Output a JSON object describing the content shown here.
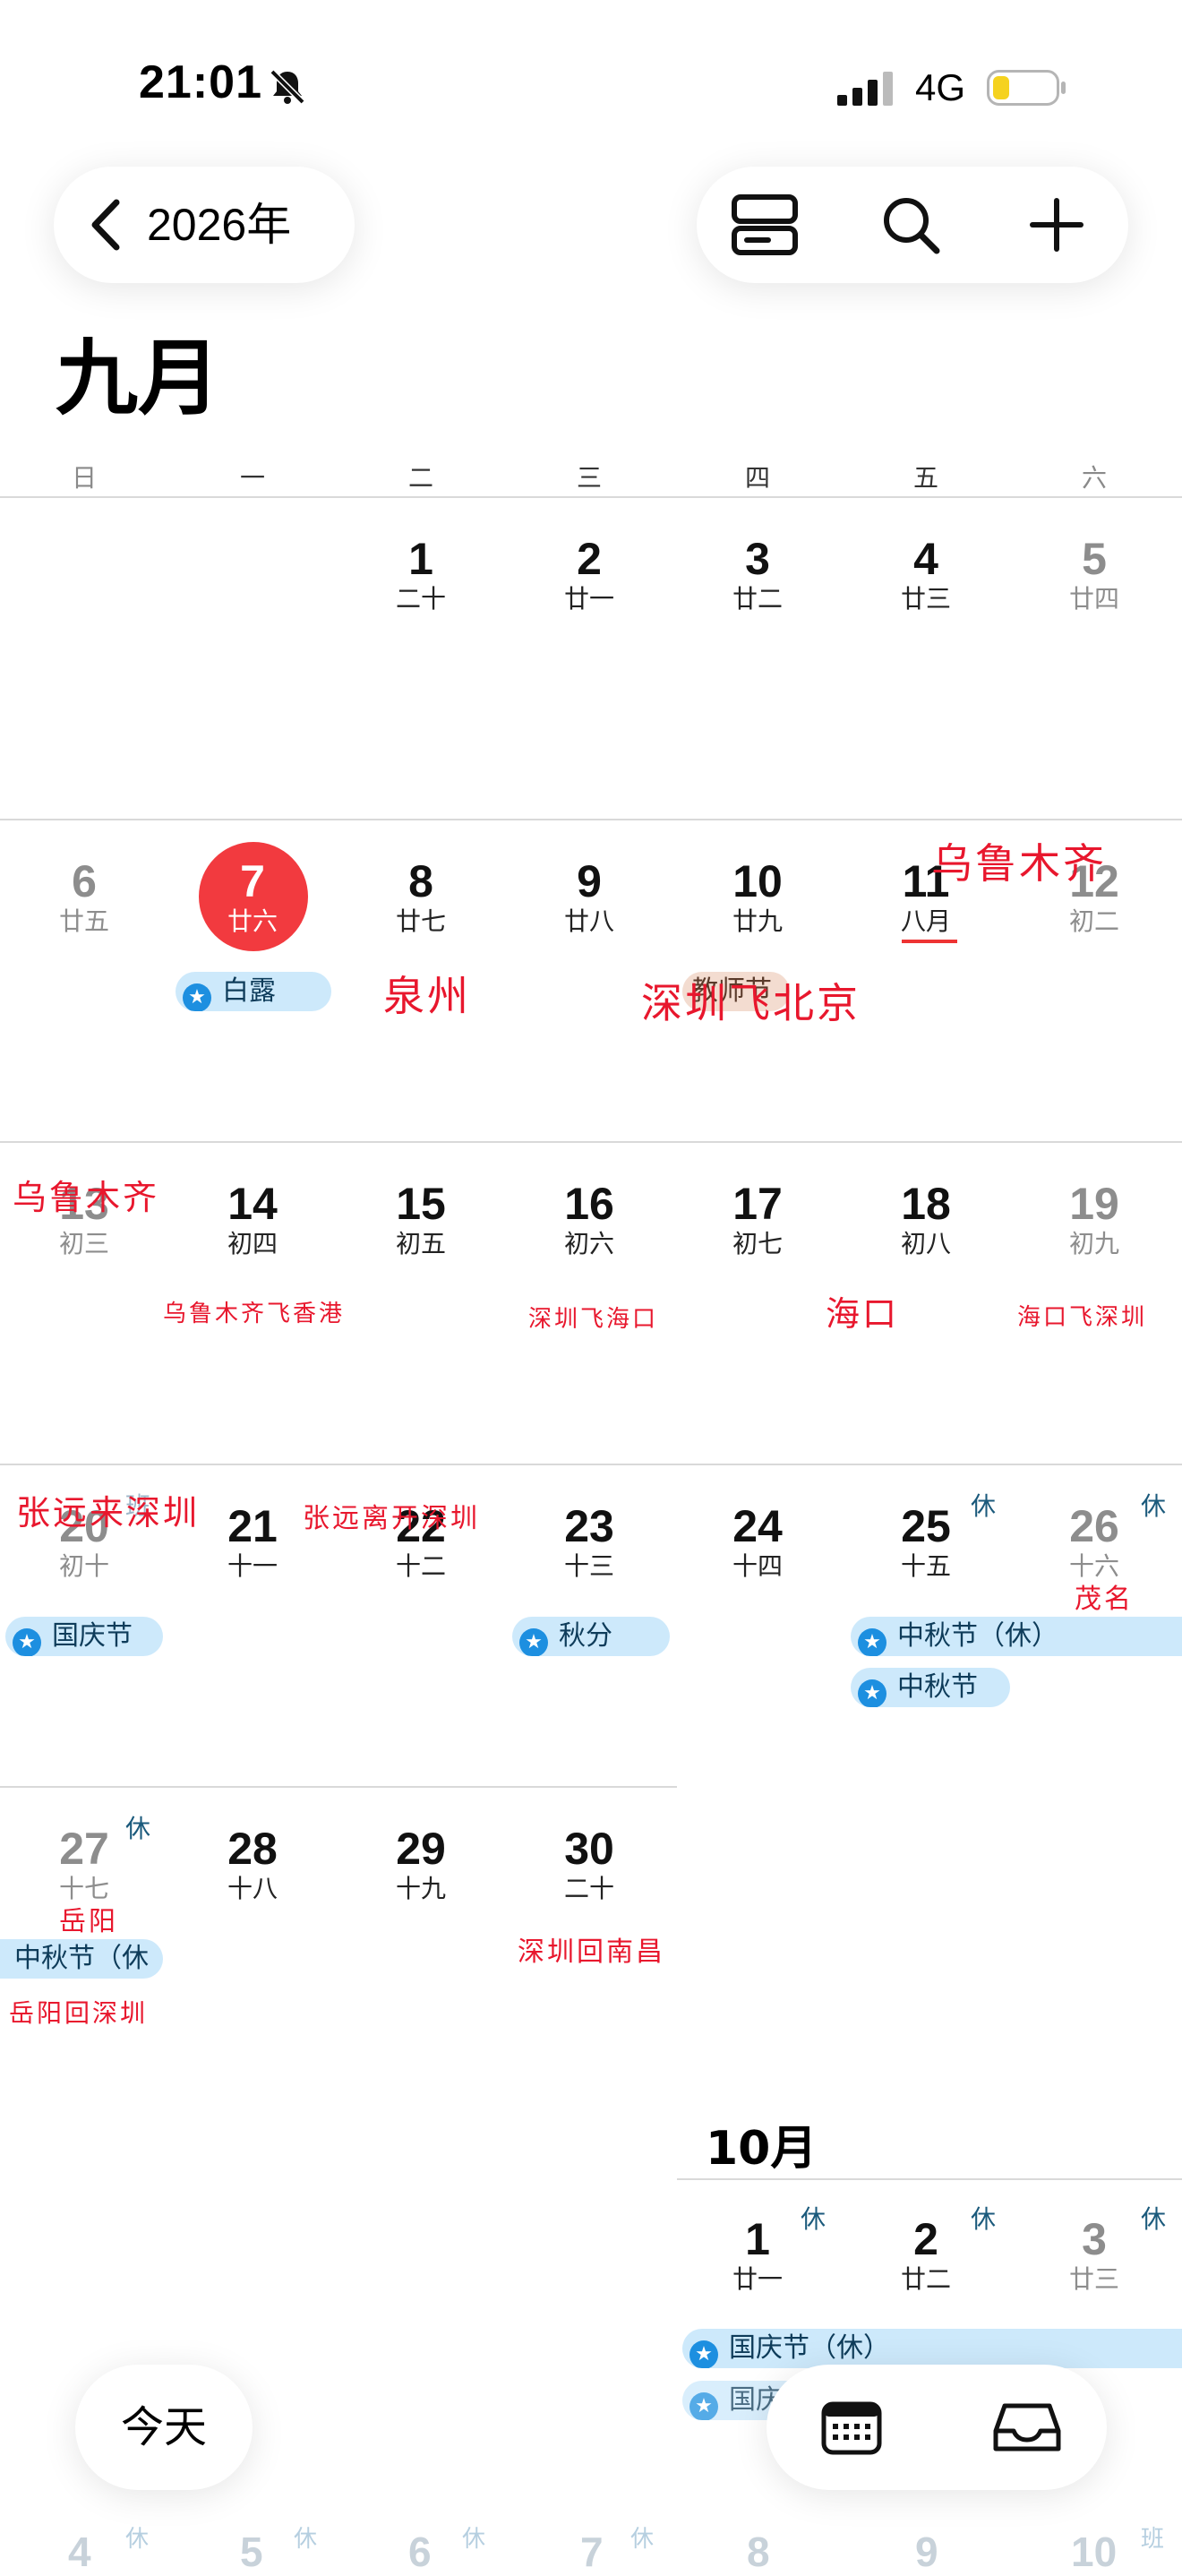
{
  "status_bar": {
    "time": "21:01",
    "network": "4G"
  },
  "toolbar": {
    "year_label": "2026年"
  },
  "month_title": "九月",
  "weekdays": [
    "日",
    "一",
    "二",
    "三",
    "四",
    "五",
    "六"
  ],
  "days": {
    "d1": [
      "1",
      "二十"
    ],
    "d2": [
      "2",
      "廿一"
    ],
    "d3": [
      "3",
      "廿二"
    ],
    "d4": [
      "4",
      "廿三"
    ],
    "d5": [
      "5",
      "廿四"
    ],
    "d6": [
      "6",
      "廿五"
    ],
    "d7": [
      "7",
      "廿六"
    ],
    "d8": [
      "8",
      "廿七"
    ],
    "d9": [
      "9",
      "廿八"
    ],
    "d10": [
      "10",
      "廿九"
    ],
    "d11": [
      "11",
      "八月"
    ],
    "d12": [
      "12",
      "初二"
    ],
    "d13": [
      "13",
      "初三"
    ],
    "d14": [
      "14",
      "初四"
    ],
    "d15": [
      "15",
      "初五"
    ],
    "d16": [
      "16",
      "初六"
    ],
    "d17": [
      "17",
      "初七"
    ],
    "d18": [
      "18",
      "初八"
    ],
    "d19": [
      "19",
      "初九"
    ],
    "d20": [
      "20",
      "初十"
    ],
    "d21": [
      "21",
      "十一"
    ],
    "d22": [
      "22",
      "十二"
    ],
    "d23": [
      "23",
      "十三"
    ],
    "d24": [
      "24",
      "十四"
    ],
    "d25": [
      "25",
      "十五"
    ],
    "d26": [
      "26",
      "十六"
    ],
    "d27": [
      "27",
      "十七"
    ],
    "d28": [
      "28",
      "十八"
    ],
    "d29": [
      "29",
      "十九"
    ],
    "d30": [
      "30",
      "二十"
    ]
  },
  "rest_badge": "休",
  "work_badge": "班",
  "events": {
    "bailu": "白露",
    "jiaoshijie": "教师节",
    "guoqing": "国庆节",
    "qiufen": "秋分",
    "zhongqiu_rest": "中秋节（休）",
    "zhongqiu": "中秋节",
    "zhongqiu_rest_cut": "中秋节（休",
    "guoqing_rest": "国庆节（休）",
    "guoqing_cut": "国庆"
  },
  "notes": {
    "quanzhou": "泉州",
    "shenzhen_beijing": "深圳飞北京",
    "wulumuqi_top": "乌鲁木齐",
    "wulumuqi_left": "乌鲁木齐",
    "wlmq_hk": "乌鲁木齐飞香港",
    "sz_haikou": "深圳飞海口",
    "haikou": "海口",
    "haikou_sz": "海口飞深圳",
    "zhangyuan_come": "张远来深圳",
    "zhangyuan_leave": "张远离开深圳",
    "maoming": "茂名",
    "yueyang": "岳阳",
    "sz_nanchang": "深圳回南昌",
    "yueyang_sz": "岳阳回深圳"
  },
  "october": {
    "title": "10月",
    "days": [
      [
        "1",
        "廿一"
      ],
      [
        "2",
        "廿二"
      ],
      [
        "3",
        "廿三"
      ]
    ],
    "faded_days": [
      "4",
      "5",
      "6",
      "7",
      "8",
      "9",
      "10"
    ]
  },
  "bottom": {
    "today_label": "今天"
  }
}
